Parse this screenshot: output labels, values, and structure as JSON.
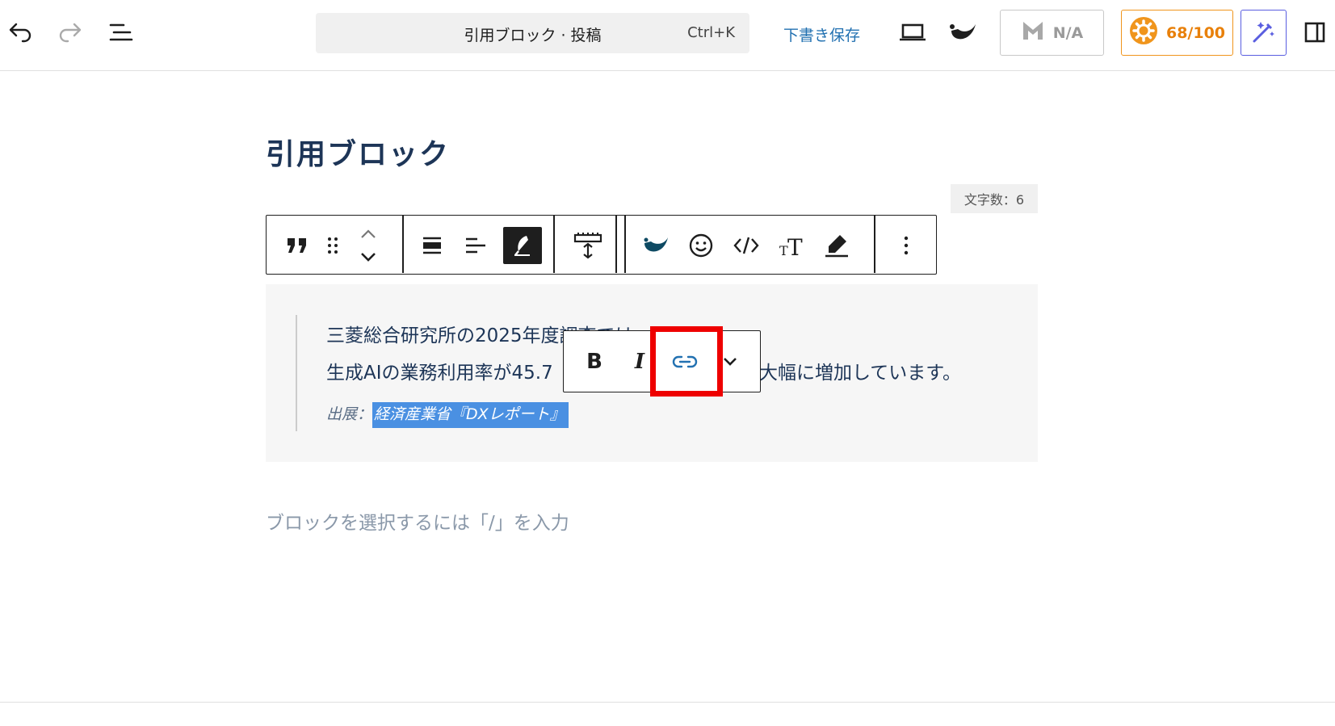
{
  "topbar": {
    "command_title": "引用ブロック · 投稿",
    "command_shortcut": "Ctrl+K",
    "save_draft": "下書き保存",
    "seo_label": "N/A",
    "score_label": "68/100",
    "icons": [
      "undo-icon",
      "redo-icon",
      "document-overview-icon",
      "preview-laptop-icon",
      "jetpack-brush-icon",
      "seo-icon",
      "score-gear-icon",
      "ai-magic-icon",
      "sidebar-toggle-icon"
    ],
    "accent_color": "#2271b1",
    "score_color": "#e8800a",
    "magic_color": "#5a5ee0"
  },
  "post": {
    "title": "引用ブロック",
    "char_count": "文字数：6"
  },
  "block_toolbar": {
    "icons": [
      "quote-icon",
      "drag-handle-icon",
      "move-up-icon",
      "move-down-icon",
      "align-wide-icon",
      "align-left-icon",
      "pen-style-icon",
      "block-spacing-icon",
      "brush-icon",
      "emoji-icon",
      "code-icon",
      "text-size-icon",
      "highlighter-icon",
      "more-options-icon"
    ]
  },
  "quote": {
    "line1": "三菱総合研究所の2025年度調査では、",
    "line2_before": "生成AIの業務利用率が45.7",
    "line2_after": "大幅に増加しています。",
    "citation_prefix": "出展：",
    "citation_selected": "経済産業省『DXレポート』"
  },
  "inline_toolbar": {
    "bold": "B",
    "italic": "I",
    "icons": [
      "link-icon",
      "chevron-down-icon"
    ]
  },
  "placeholder": "ブロックを選択するには「/」を入力"
}
